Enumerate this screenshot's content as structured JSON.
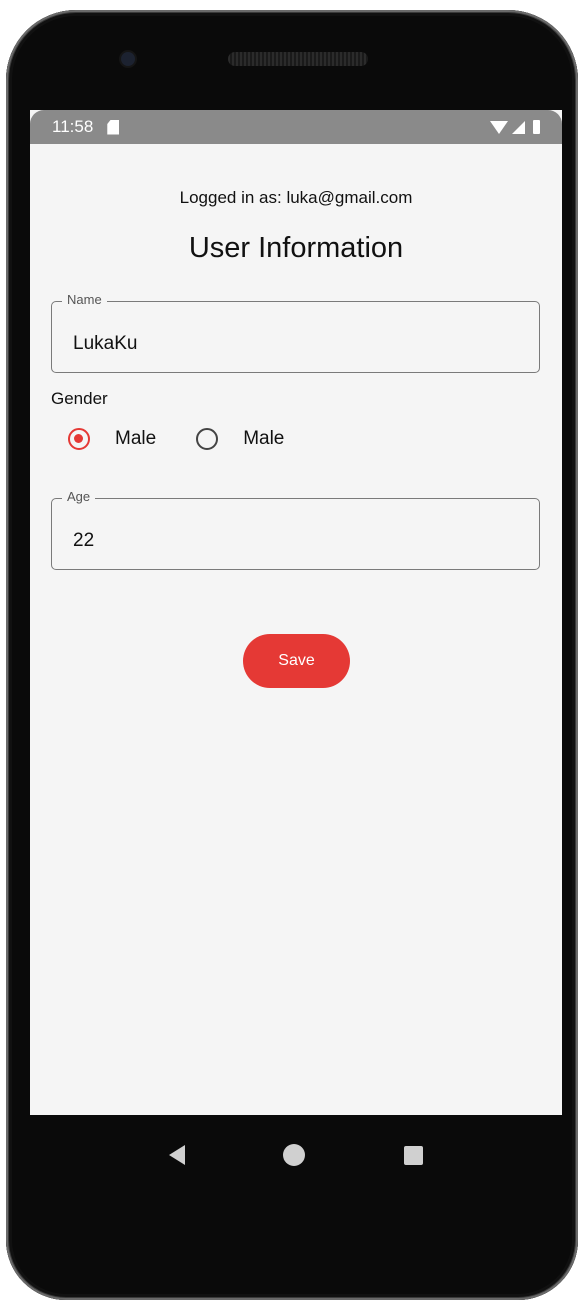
{
  "status_bar": {
    "time": "11:58"
  },
  "header": {
    "logged_in_text": "Logged in as: luka@gmail.com",
    "title": "User Information"
  },
  "form": {
    "name": {
      "label": "Name",
      "value": "LukaKu"
    },
    "gender": {
      "label": "Gender",
      "options": [
        {
          "label": "Male",
          "selected": true
        },
        {
          "label": "Male",
          "selected": false
        }
      ]
    },
    "age": {
      "label": "Age",
      "value": "22"
    },
    "save_label": "Save"
  },
  "colors": {
    "accent": "#e53935",
    "screen_bg": "#f5f5f5",
    "status_bar_bg": "#8a8a8a"
  },
  "icons": {
    "status_left": [
      "sd-card-icon"
    ],
    "status_right": [
      "wifi-icon",
      "signal-icon",
      "battery-icon"
    ],
    "navigation": [
      "back-icon",
      "home-icon",
      "recents-icon"
    ]
  }
}
